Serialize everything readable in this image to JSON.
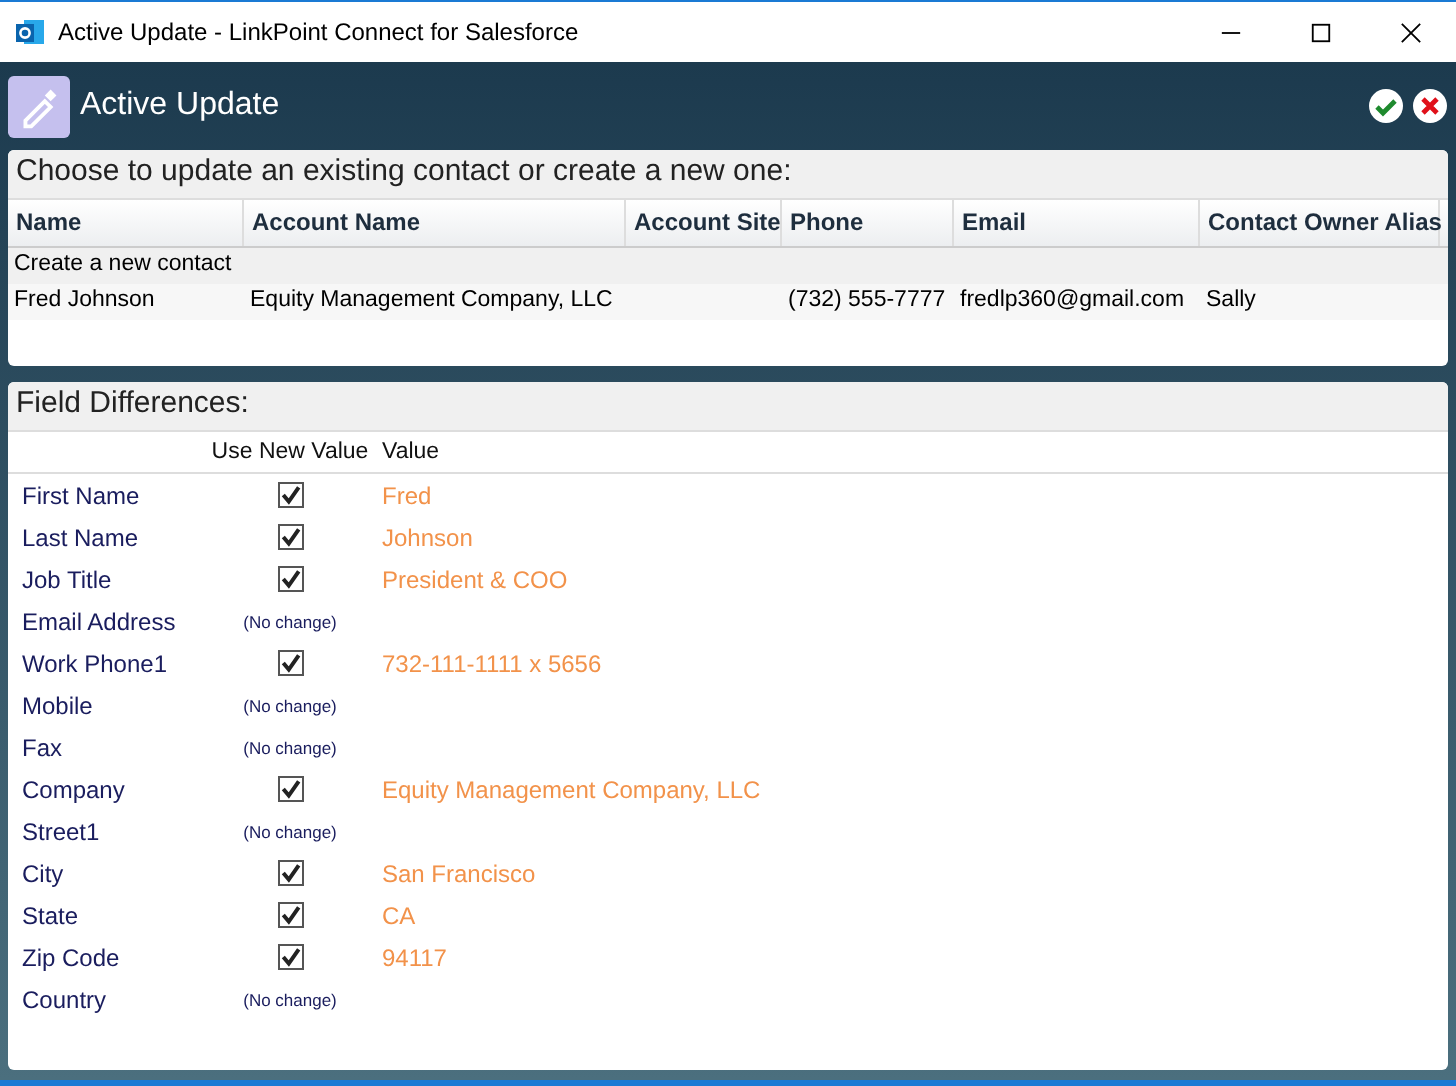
{
  "window": {
    "title": "Active Update - LinkPoint Connect for Salesforce"
  },
  "header": {
    "title": "Active Update"
  },
  "contacts": {
    "heading": "Choose to update an existing contact or create a new one:",
    "columns": [
      "Name",
      "Account Name",
      "Account Site",
      "Phone",
      "Email",
      "Contact Owner Alias"
    ],
    "rows": [
      {
        "cells": [
          "Create a new contact",
          "",
          "",
          "",
          "",
          ""
        ]
      },
      {
        "cells": [
          "Fred Johnson",
          "Equity Management Company, LLC",
          "",
          "(732) 555-7777",
          "fredlp360@gmail.com",
          "Sally"
        ]
      }
    ]
  },
  "differences": {
    "heading": "Field Differences:",
    "columns": [
      "Use New Value",
      "Value"
    ],
    "fields": [
      {
        "label": "First Name",
        "kind": "checkbox",
        "checked": true,
        "value": "Fred"
      },
      {
        "label": "Last Name",
        "kind": "checkbox",
        "checked": true,
        "value": "Johnson"
      },
      {
        "label": "Job Title",
        "kind": "checkbox",
        "checked": true,
        "value": "President & COO"
      },
      {
        "label": "Email Address",
        "kind": "nochange",
        "note": "(No change)"
      },
      {
        "label": "Work Phone1",
        "kind": "checkbox",
        "checked": true,
        "value": "732-111-1111 x 5656"
      },
      {
        "label": "Mobile",
        "kind": "nochange",
        "note": "(No change)"
      },
      {
        "label": "Fax",
        "kind": "nochange",
        "note": "(No change)"
      },
      {
        "label": "Company",
        "kind": "checkbox",
        "checked": true,
        "value": "Equity Management Company, LLC"
      },
      {
        "label": "Street1",
        "kind": "nochange",
        "note": "(No change)"
      },
      {
        "label": "City",
        "kind": "checkbox",
        "checked": true,
        "value": "San Francisco"
      },
      {
        "label": "State",
        "kind": "checkbox",
        "checked": true,
        "value": "CA"
      },
      {
        "label": "Zip Code",
        "kind": "checkbox",
        "checked": true,
        "value": "94117"
      },
      {
        "label": "Country",
        "kind": "nochange",
        "note": "(No change)"
      }
    ]
  }
}
